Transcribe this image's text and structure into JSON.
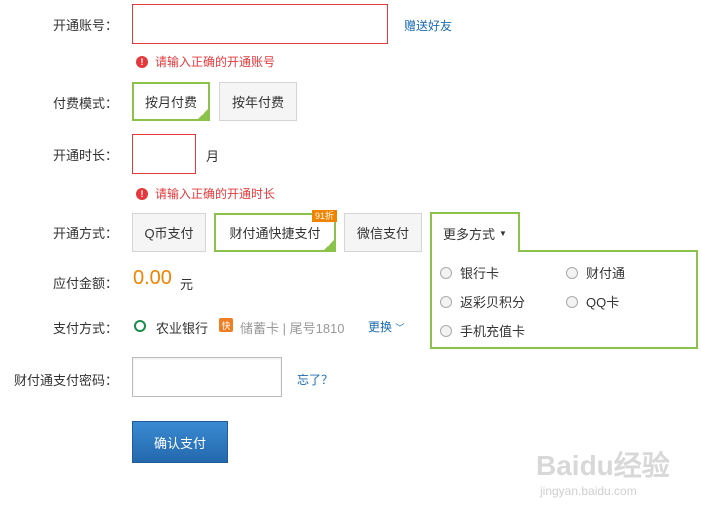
{
  "account": {
    "label": "开通账号",
    "value": "",
    "gift_link": "赠送好友",
    "error": "请输入正确的开通账号"
  },
  "payment_mode": {
    "label": "付费模式",
    "options": [
      "按月付费",
      "按年付费"
    ],
    "selected": "按月付费"
  },
  "duration": {
    "label": "开通时长",
    "value": "",
    "unit": "月",
    "error": "请输入正确的开通时长"
  },
  "method": {
    "label": "开通方式",
    "options": [
      "Q币支付",
      "财付通快捷支付",
      "微信支付"
    ],
    "selected": "财付通快捷支付",
    "discount_badge": "91折",
    "more_label": "更多方式",
    "more_options": [
      "银行卡",
      "财付通",
      "返彩贝积分",
      "QQ卡",
      "手机充值卡"
    ]
  },
  "amount": {
    "label": "应付金额",
    "value": "0.00",
    "unit": "元"
  },
  "pay_way": {
    "label": "支付方式",
    "bank": "农业银行",
    "quick_icon": "快",
    "card_info": "储蓄卡 | 尾号1810",
    "change_link": "更换"
  },
  "password": {
    "label": "财付通支付密码",
    "value": "",
    "forgot_link": "忘了？"
  },
  "submit_label": "确认支付",
  "watermark": {
    "brand": "Baidu经验",
    "url": "jingyan.baidu.com"
  },
  "colors": {
    "accent_green": "#8bc34a",
    "error_red": "#e4393c",
    "amount_orange": "#f08300",
    "link_blue": "#1a6cb4",
    "button_blue": "#2b7bc5"
  }
}
